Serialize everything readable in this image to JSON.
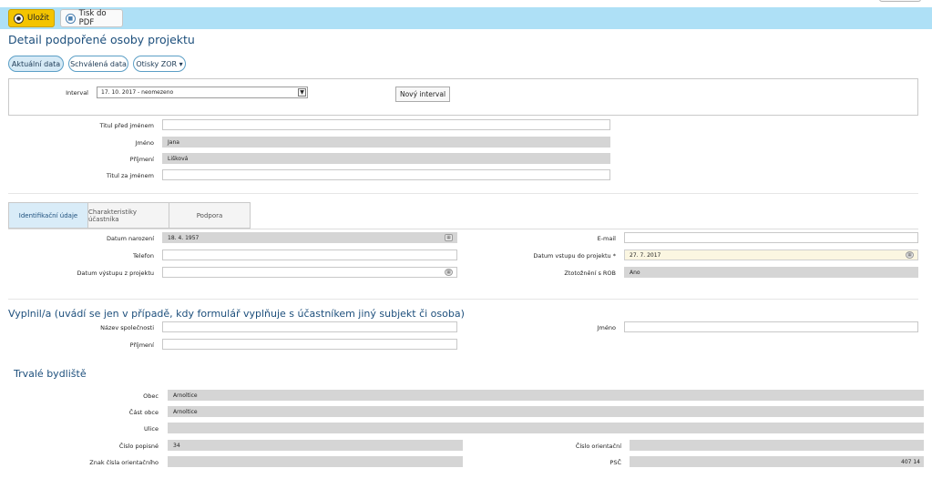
{
  "toolbar": {
    "save_label": "Uložit",
    "pdf_label": "Tisk do PDF"
  },
  "page": {
    "title": "Detail podpořené osoby projektu"
  },
  "view_tabs": {
    "current": "Aktuální data",
    "approved": "Schválená data",
    "zor": "Otisky ZOR ▾"
  },
  "interval": {
    "label": "Interval",
    "value": "17. 10. 2017 - neomezeno",
    "new_button": "Nový interval"
  },
  "person": {
    "title_before_label": "Titul před jménem",
    "title_before": "",
    "first_name_label": "Jméno",
    "first_name": "Jana",
    "last_name_label": "Příjmení",
    "last_name": "Lišková",
    "title_after_label": "Titul za jménem",
    "title_after": ""
  },
  "detail_tabs": {
    "ident": "Identifikační údaje",
    "chars": "Charakteristiky účastníka",
    "support": "Podpora"
  },
  "ident": {
    "birth_label": "Datum narození",
    "birth": "18. 4. 1957",
    "phone_label": "Telefon",
    "phone": "",
    "exit_label": "Datum výstupu z projektu",
    "exit": "",
    "email_label": "E-mail",
    "email": "",
    "entry_label": "Datum vstupu do projektu *",
    "entry": "27. 7. 2017",
    "rob_label": "Ztotožnění s ROB",
    "rob": "Ano"
  },
  "filled_by": {
    "title": "Vyplnil/a (uvádí se jen v případě, kdy formulář vyplňuje s účastníkem jiný subjekt či osoba)",
    "company_label": "Název společnosti",
    "company": "",
    "last_name_label": "Příjmení",
    "last_name": "",
    "first_name_label": "Jméno",
    "first_name": ""
  },
  "address": {
    "title": "Trvalé bydliště",
    "city_label": "Obec",
    "city": "Arnoltice",
    "part_label": "Část obce",
    "part": "Arnoltice",
    "street_label": "Ulice",
    "street": "",
    "cp_label": "Číslo popisné",
    "cp": "34",
    "co_label": "Číslo orientační",
    "co": "",
    "co_sign_label": "Znak čísla orientačního",
    "co_sign": "",
    "zip_label": "PSČ",
    "zip": "407 14"
  },
  "icons": {
    "save": "lock-icon",
    "pdf": "print-icon",
    "calendar": "calendar-icon",
    "dropdown": "chevron-down-icon"
  }
}
